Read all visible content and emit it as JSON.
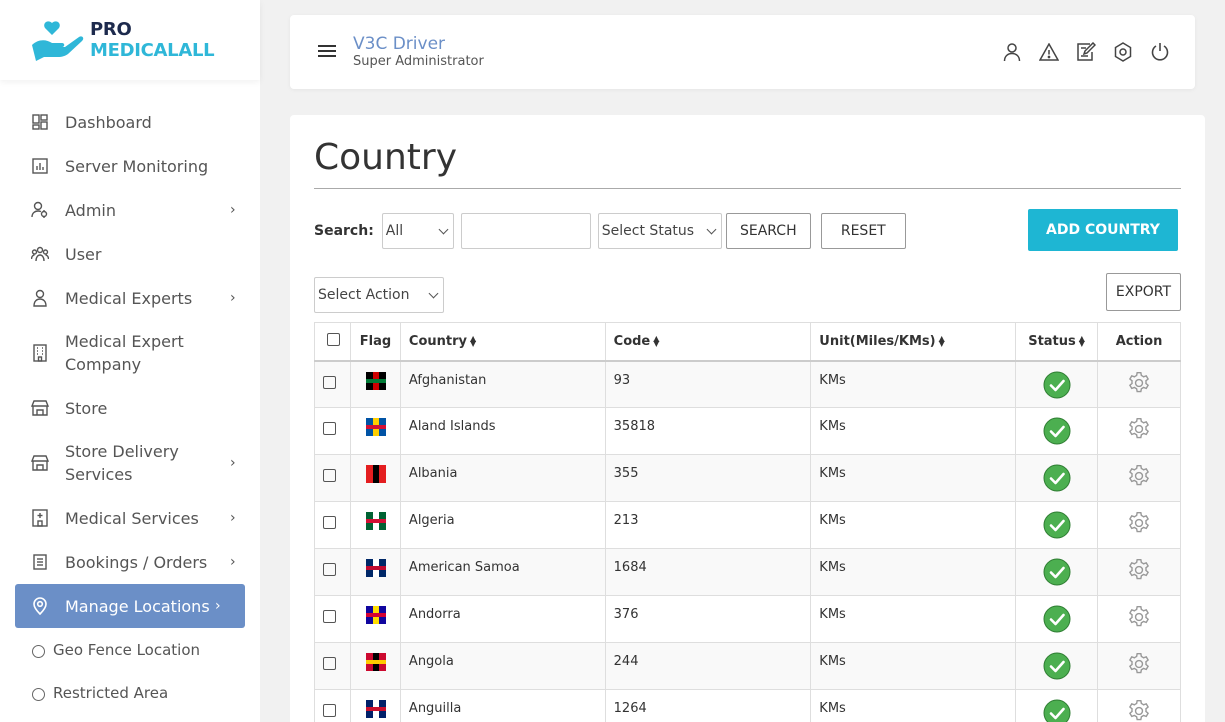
{
  "brand": {
    "part1": "PRO",
    "part2": "MEDICALALL"
  },
  "sidebar": {
    "items": [
      {
        "label": "Dashboard",
        "icon": "dashboard-icon"
      },
      {
        "label": "Server Monitoring",
        "icon": "chart-icon"
      },
      {
        "label": "Admin",
        "icon": "admin-icon"
      },
      {
        "label": "User",
        "icon": "users-icon"
      },
      {
        "label": "Medical Experts",
        "icon": "person-icon"
      },
      {
        "label": "Medical Expert Company",
        "icon": "building-icon"
      },
      {
        "label": "Store",
        "icon": "store-icon"
      },
      {
        "label": "Store Delivery Services",
        "icon": "store-icon"
      },
      {
        "label": "Medical Services",
        "icon": "hospital-icon"
      },
      {
        "label": "Bookings / Orders",
        "icon": "list-icon"
      },
      {
        "label": "Manage Locations",
        "icon": "location-pin-icon"
      }
    ],
    "sub_items": [
      {
        "label": "Geo Fence Location"
      },
      {
        "label": "Restricted Area"
      }
    ]
  },
  "header": {
    "title": "V3C Driver",
    "subtitle": "Super Administrator",
    "icons": [
      "user-icon",
      "alert-icon",
      "edit-icon",
      "settings-icon",
      "power-icon"
    ]
  },
  "page": {
    "title": "Country",
    "search_label": "Search:",
    "search_field_value": "All",
    "search_input_value": "",
    "status_select": "Select Status",
    "search_button": "SEARCH",
    "reset_button": "RESET",
    "add_button": "ADD COUNTRY",
    "action_select": "Select Action",
    "export_button": "EXPORT"
  },
  "table": {
    "headers": [
      "Flag",
      "Country",
      "Code",
      "Unit(Miles/KMs)",
      "Status",
      "Action"
    ],
    "rows": [
      {
        "country": "Afghanistan",
        "code": "93",
        "unit": "KMs",
        "flag_colors": [
          "#000000",
          "#cc0000",
          "#007a36"
        ]
      },
      {
        "country": "Aland Islands",
        "code": "35818",
        "unit": "KMs",
        "flag_colors": [
          "#0053a5",
          "#ffce00",
          "#d21034"
        ]
      },
      {
        "country": "Albania",
        "code": "355",
        "unit": "KMs",
        "flag_colors": [
          "#e41e20",
          "#000000"
        ]
      },
      {
        "country": "Algeria",
        "code": "213",
        "unit": "KMs",
        "flag_colors": [
          "#006233",
          "#ffffff",
          "#d21034"
        ]
      },
      {
        "country": "American Samoa",
        "code": "1684",
        "unit": "KMs",
        "flag_colors": [
          "#002868",
          "#ffffff",
          "#bf0a30"
        ]
      },
      {
        "country": "Andorra",
        "code": "376",
        "unit": "KMs",
        "flag_colors": [
          "#10069f",
          "#fedd00",
          "#d50032"
        ]
      },
      {
        "country": "Angola",
        "code": "244",
        "unit": "KMs",
        "flag_colors": [
          "#cc092f",
          "#000000",
          "#ffcb00"
        ]
      },
      {
        "country": "Anguilla",
        "code": "1264",
        "unit": "KMs",
        "flag_colors": [
          "#012169",
          "#ffffff",
          "#c8102e"
        ]
      }
    ]
  },
  "colors": {
    "accent": "#6b8fc7",
    "add_button": "#1eb6d3",
    "status_active": "#4caf50"
  }
}
